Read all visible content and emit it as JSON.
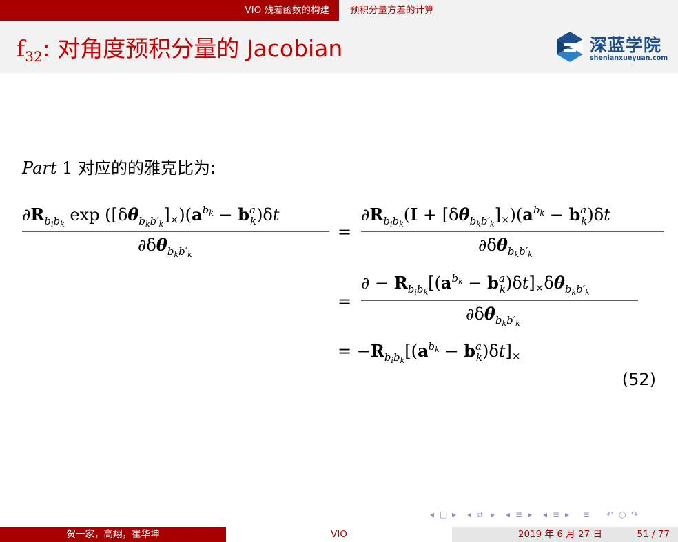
{
  "nav": {
    "section_left": "VIO 残差函数的构建",
    "section_right": "预积分量方差的计算"
  },
  "header": {
    "title_symbol": "f",
    "title_subscript": "32",
    "title_text": ": 对角度预积分量的 Jacobian"
  },
  "logo": {
    "name_cn": "深蓝学院",
    "domain": "shenlanxueyuan.com"
  },
  "body": {
    "part_italic": "Part",
    "part_number": "1",
    "part_text": "对应的的雅克比为:"
  },
  "equation": {
    "lhs_numerator": "∂R_{b_i b_k} exp([δθ_{b_k b'_k}]×)(a^{b_k} − b^a_k)δt",
    "lhs_denominator": "∂δθ_{b_k b'_k}",
    "step1_numerator": "∂R_{b_i b_k}(I + [δθ_{b_k b'_k}]×)(a^{b_k} − b^a_k)δt",
    "step1_denominator": "∂δθ_{b_k b'_k}",
    "step2_numerator": "∂ − R_{b_i b_k}[(a^{b_k} − b^a_k)δt]× δθ_{b_k b'_k}",
    "step2_denominator": "∂δθ_{b_k b'_k}",
    "step3": "= −R_{b_i b_k}[(a^{b_k} − b^a_k)δt]×",
    "number": "(52)"
  },
  "footer": {
    "authors": "贺一家，高翔，崔华坤",
    "short_title": "VIO",
    "date": "2019 年 6 月 27 日",
    "page": "51 / 77"
  },
  "colors": {
    "brand_red": "#a80000",
    "title_red": "#c80000",
    "band_gray": "#f2f2f2",
    "logo_blue": "#1f4e8c",
    "nav_symbol": "#8a8ad6"
  }
}
